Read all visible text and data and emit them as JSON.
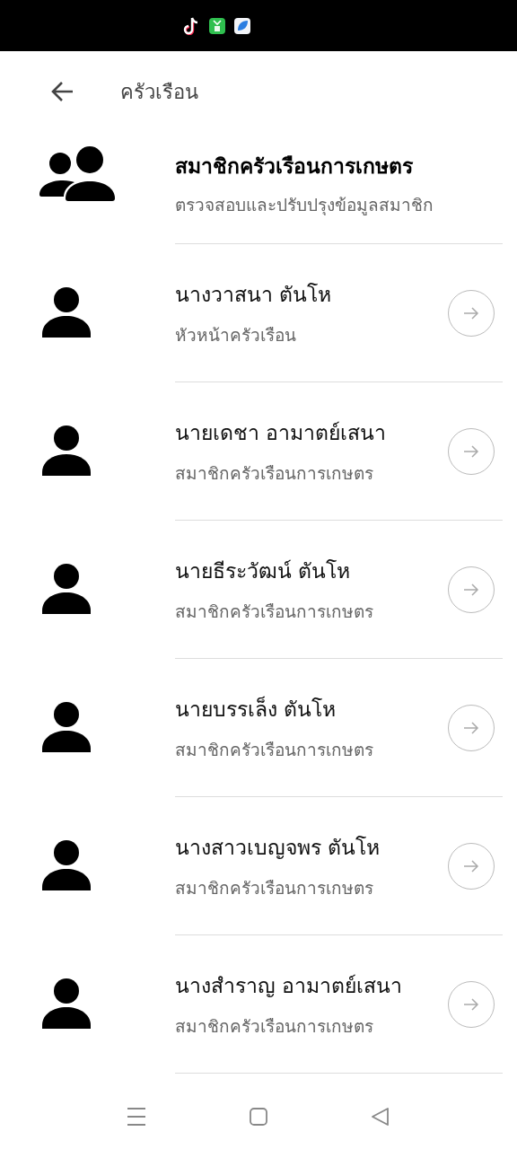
{
  "status_bar": {
    "app_icons": [
      {
        "kind": "note"
      },
      {
        "kind": "bag"
      },
      {
        "kind": "leaf"
      }
    ]
  },
  "header": {
    "title": "ครัวเรือน"
  },
  "group": {
    "title": "สมาชิกครัวเรือนการเกษตร",
    "subtitle": "ตรวจสอบและปรับปรุงข้อมูลสมาชิก"
  },
  "members": [
    {
      "name": "นางวาสนา ตันโห",
      "role": "หัวหน้าครัวเรือน"
    },
    {
      "name": "นายเดชา อามาตย์เสนา",
      "role": "สมาชิกครัวเรือนการเกษตร"
    },
    {
      "name": "นายธีระวัฒน์ ตันโห",
      "role": "สมาชิกครัวเรือนการเกษตร"
    },
    {
      "name": "นายบรรเล็ง ตันโห",
      "role": "สมาชิกครัวเรือนการเกษตร"
    },
    {
      "name": "นางสาวเบญจพร ตันโห",
      "role": "สมาชิกครัวเรือนการเกษตร"
    },
    {
      "name": "นางสำราญ อามาตย์เสนา",
      "role": "สมาชิกครัวเรือนการเกษตร"
    }
  ],
  "nav_bar": {
    "buttons": [
      {
        "kind": "menu"
      },
      {
        "kind": "home"
      },
      {
        "kind": "back"
      }
    ]
  }
}
